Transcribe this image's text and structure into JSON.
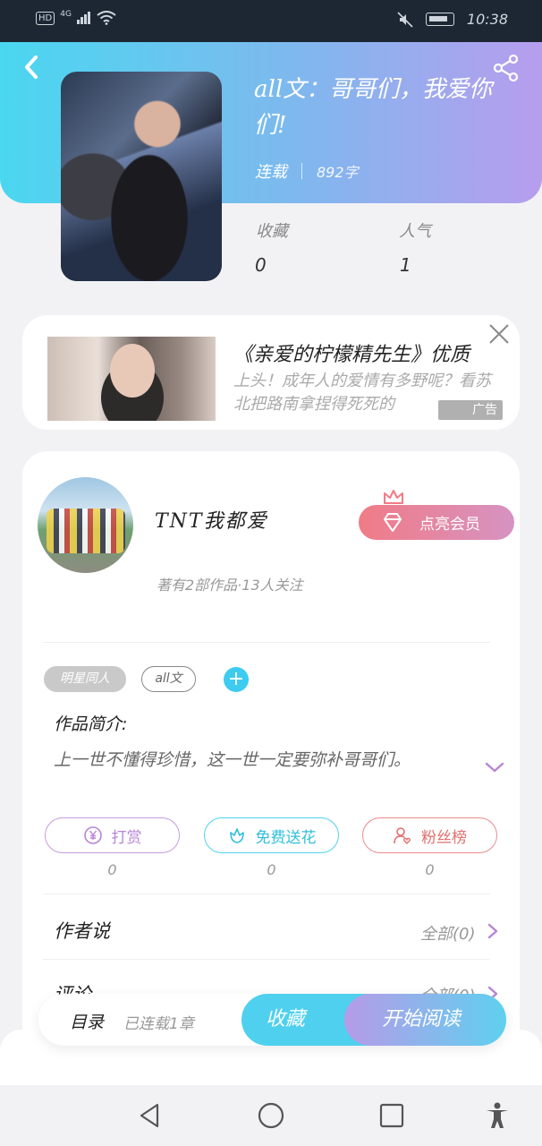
{
  "status_bar": {
    "hd": "HD",
    "network": "4G",
    "time": "10:38"
  },
  "book": {
    "title": "all文：哥哥们，我爱你们!",
    "status": "连载",
    "word_count": "892字",
    "stats": [
      {
        "label": "收藏",
        "value": "0"
      },
      {
        "label": "人气",
        "value": "1"
      }
    ]
  },
  "ad": {
    "title": "《亲爱的柠檬精先生》优质",
    "description": "上头！成年人的爱情有多野呢？看苏北把路南拿捏得死死的",
    "tag": "广告"
  },
  "author": {
    "name": "TNT我都爱",
    "meta": "著有2部作品·13人关注",
    "vip_button": "点亮会员"
  },
  "tags": [
    "明星同人",
    "all文"
  ],
  "add_tag_symbol": "+",
  "intro": {
    "label": "作品简介:",
    "text": "上一世不懂得珍惜，这一世一定要弥补哥哥们。"
  },
  "actions": [
    {
      "label": "打赏",
      "count": "0",
      "color": "#b784d6"
    },
    {
      "label": "免费送花",
      "count": "0",
      "color": "#31bfdc"
    },
    {
      "label": "粉丝榜",
      "count": "0",
      "color": "#e26f6f"
    }
  ],
  "rows": [
    {
      "label": "作者说",
      "more": "全部(0)"
    },
    {
      "label": "评论",
      "more": "全部(0)"
    }
  ],
  "bottom": {
    "toc": "目录",
    "toc_sub": "已连载1章",
    "favorite": "收藏",
    "read": "开始阅读"
  },
  "icons": [
    "back-icon",
    "share-icon",
    "close-icon",
    "crown-icon",
    "gem-icon",
    "chevron-down-icon",
    "yen-icon",
    "flower-icon",
    "user-heart-icon",
    "chevron-right-icon",
    "nav-back-icon",
    "nav-home-icon",
    "nav-recent-icon",
    "accessibility-icon"
  ]
}
